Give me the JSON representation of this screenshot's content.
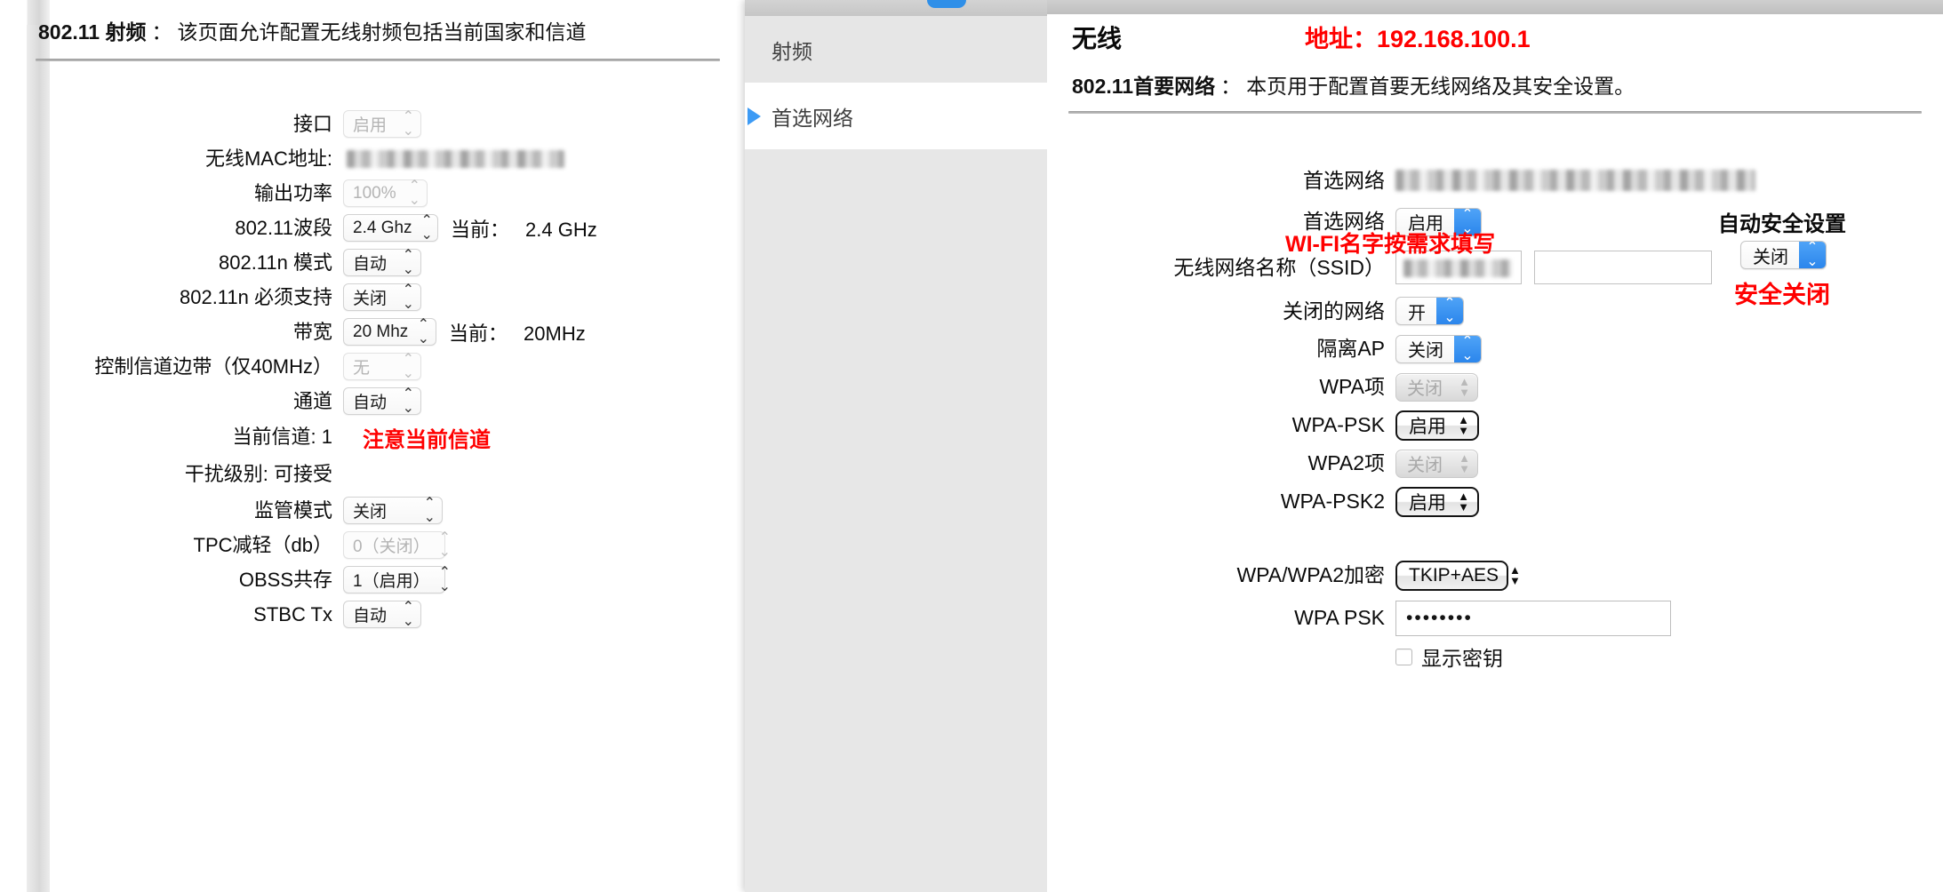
{
  "left_window": {
    "page_header": {
      "title": "802.11 射频",
      "separator": "：",
      "description": "该页面允许配置无线射频包括当前国家和信道"
    },
    "rows": [
      {
        "label": "接口",
        "control": "select_dim",
        "value": "启用",
        "after": ""
      },
      {
        "label": "无线MAC地址:",
        "control": "redacted",
        "value": "",
        "after": ""
      },
      {
        "label": "输出功率",
        "control": "select_dim",
        "value": "100%",
        "after": ""
      },
      {
        "label": "802.11波段",
        "control": "select",
        "value": "2.4 Ghz",
        "after_prefix": "当前：",
        "after_value": "2.4 GHz"
      },
      {
        "label": "802.11n 模式",
        "control": "select",
        "value": "自动",
        "after": ""
      },
      {
        "label": "802.11n 必须支持",
        "control": "select",
        "value": "关闭",
        "after": ""
      },
      {
        "label": "带宽",
        "control": "select",
        "value": "20 Mhz",
        "after_prefix": "当前：",
        "after_value": "20MHz"
      },
      {
        "label": "控制信道边带（仅40MHz）",
        "control": "select_dim",
        "value": "无",
        "after": ""
      },
      {
        "label": "通道",
        "control": "select",
        "value": "自动",
        "after": ""
      },
      {
        "label": "当前信道: 1",
        "control": "text",
        "value": "",
        "after": ""
      },
      {
        "label": "干扰级别: 可接受",
        "control": "text",
        "value": "",
        "after": ""
      },
      {
        "label": "监管模式",
        "control": "select",
        "value": "关闭",
        "after": ""
      },
      {
        "label": "TPC减轻（db）",
        "control": "select_dim",
        "value": "0（关闭）",
        "after": ""
      },
      {
        "label": "OBSS共存",
        "control": "select",
        "value": "1（启用）",
        "after": ""
      },
      {
        "label": "STBC Tx",
        "control": "select",
        "value": "自动",
        "after": ""
      }
    ],
    "annotation_channel": "注意当前信道"
  },
  "nav_window": {
    "items": [
      {
        "label": "射频",
        "active": false
      },
      {
        "label": "首选网络",
        "active": true
      }
    ]
  },
  "right_window": {
    "title": "无线",
    "address_annotation": "地址：192.168.100.1",
    "page_header": {
      "title": "802.11首要网络",
      "separator": "：",
      "description": "本页用于配置首要无线网络及其安全设置。"
    },
    "rows": [
      {
        "label": "首选网络",
        "control": "redacted",
        "value": ""
      },
      {
        "label": "首选网络",
        "control": "select_blue",
        "value": "启用"
      },
      {
        "label": "无线网络名称（SSID）",
        "control": "ssid_inputs",
        "value": ""
      },
      {
        "label": "关闭的网络",
        "control": "select_blue",
        "value": "开"
      },
      {
        "label": "隔离AP",
        "control": "select_blue",
        "value": "关闭"
      },
      {
        "label": "WPA项",
        "control": "select_disabled",
        "value": "关闭"
      },
      {
        "label": "WPA-PSK",
        "control": "select_black",
        "value": "启用"
      },
      {
        "label": "WPA2项",
        "control": "select_disabled",
        "value": "关闭"
      },
      {
        "label": "WPA-PSK2",
        "control": "select_black",
        "value": "启用"
      },
      {
        "label": "WPA/WPA2加密",
        "control": "select_black",
        "value": "TKIP+AES"
      },
      {
        "label": "WPA PSK",
        "control": "password",
        "value": "••••••••"
      }
    ],
    "show_key_label": "显示密钥",
    "auto_security": {
      "title": "自动安全设置",
      "value": "关闭",
      "annotation": "安全关闭"
    },
    "annotation_ssid": "WI-FI名字按需求填写"
  },
  "icons": {
    "chevron_updown": "⌃⌄",
    "triangle_right": "triangle-right-icon",
    "updown_solid": "▲▼"
  },
  "colors": {
    "annotation_red": "#ff0000",
    "accent_blue": "#2b86ec",
    "nav_inactive_bg": "#e6e6e6"
  }
}
